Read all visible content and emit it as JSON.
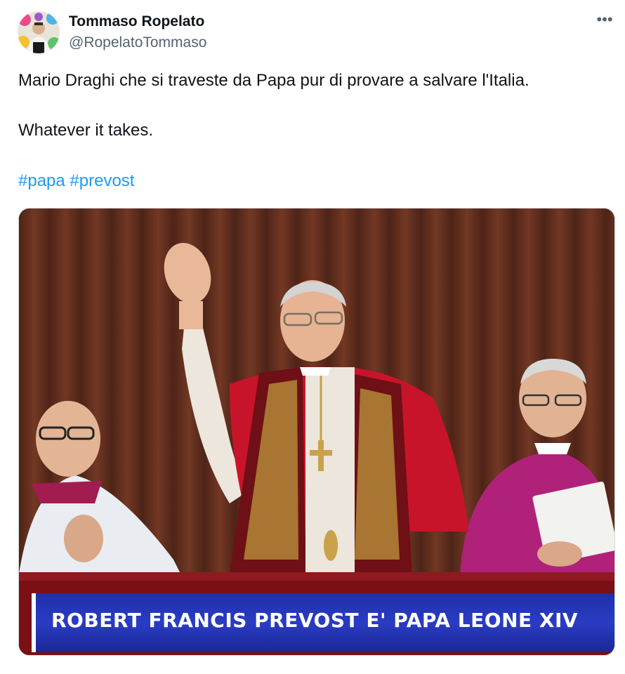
{
  "author": {
    "display_name": "Tommaso Ropelato",
    "handle": "@RopelatoTommaso"
  },
  "more_icon": "more-horizontal-icon",
  "tweet": {
    "line1": "Mario Draghi che si traveste da Papa pur di provare a salvare l'Italia.",
    "line2": "Whatever it takes.",
    "hashtags": [
      "#papa",
      "#prevost"
    ]
  },
  "media": {
    "caption": "ROBERT FRANCIS PREVOST E' PAPA LEONE XIV"
  },
  "colors": {
    "link": "#1d9bf0",
    "secondary_text": "#536471",
    "banner": "#2a3cc4"
  }
}
